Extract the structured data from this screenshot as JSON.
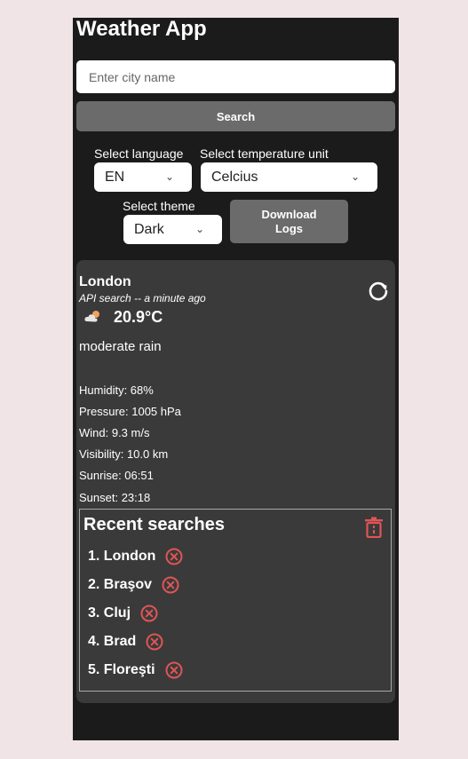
{
  "app": {
    "title": "Weather App"
  },
  "search": {
    "placeholder": "Enter city name",
    "button_label": "Search"
  },
  "controls": {
    "language": {
      "label": "Select language",
      "value": "EN"
    },
    "unit": {
      "label": "Select temperature unit",
      "value": "Celcius"
    },
    "theme": {
      "label": "Select theme",
      "value": "Dark"
    },
    "download_logs_line1": "Download",
    "download_logs_line2": "Logs"
  },
  "weather": {
    "city": "London",
    "source": "API search -- a minute ago",
    "temperature": "20.9°C",
    "description": "moderate rain",
    "details": {
      "humidity": "Humidity: 68%",
      "pressure": "Pressure: 1005 hPa",
      "wind": "Wind: 9.3 m/s",
      "visibility": "Visibility: 10.0 km",
      "sunrise": "Sunrise: 06:51",
      "sunset": "Sunset: 23:18"
    }
  },
  "recent": {
    "title": "Recent searches",
    "items": [
      "1. London",
      "2. Braşov",
      "3. Cluj",
      "4. Brad",
      "5. Floreşti"
    ]
  },
  "colors": {
    "accent_red": "#e05555",
    "card_bg": "#3a3a3a",
    "app_bg": "#1b1b1b",
    "page_bg": "#f0e4e6"
  }
}
